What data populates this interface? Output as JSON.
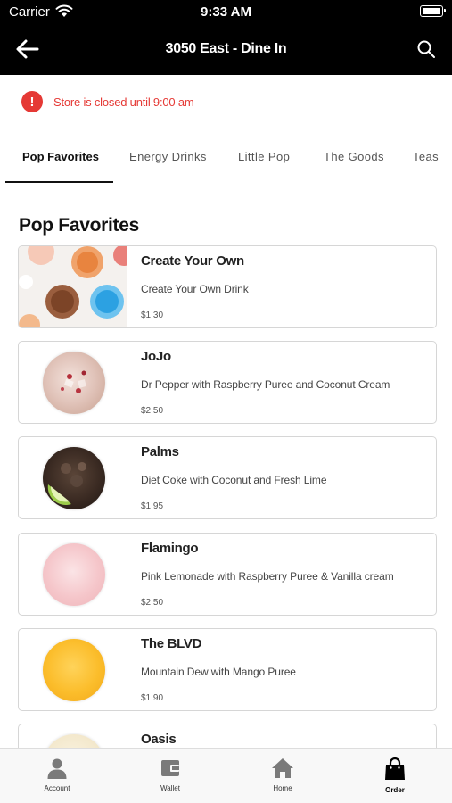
{
  "status_bar": {
    "carrier": "Carrier",
    "time": "9:33 AM"
  },
  "header": {
    "title": "3050 East - Dine In"
  },
  "alert": {
    "text": "Store is closed until 9:00 am"
  },
  "tabs": [
    "Pop Favorites",
    "Energy Drinks",
    "Little Pop",
    "The Goods",
    "Teas"
  ],
  "section": {
    "title": "Pop Favorites"
  },
  "items": [
    {
      "name": "Create Your Own",
      "description": "Create Your Own Drink",
      "price": "$1.30"
    },
    {
      "name": "JoJo",
      "description": "Dr Pepper with Raspberry Puree and Coconut Cream",
      "price": "$2.50"
    },
    {
      "name": "Palms",
      "description": "Diet Coke with Coconut and Fresh Lime",
      "price": "$1.95"
    },
    {
      "name": "Flamingo",
      "description": "Pink Lemonade with Raspberry Puree & Vanilla cream",
      "price": "$2.50"
    },
    {
      "name": "The BLVD",
      "description": "Mountain Dew with Mango Puree",
      "price": "$1.90"
    },
    {
      "name": "Oasis",
      "description": "",
      "price": ""
    }
  ],
  "bottom_nav": [
    {
      "label": "Account",
      "icon": "person-icon"
    },
    {
      "label": "Wallet",
      "icon": "wallet-icon"
    },
    {
      "label": "Home",
      "icon": "home-icon"
    },
    {
      "label": "Order",
      "icon": "shopping-bag-icon",
      "active": true
    }
  ],
  "colors": {
    "header_bg": "#000000",
    "alert_red": "#e53935",
    "active_tab": "#111111"
  }
}
